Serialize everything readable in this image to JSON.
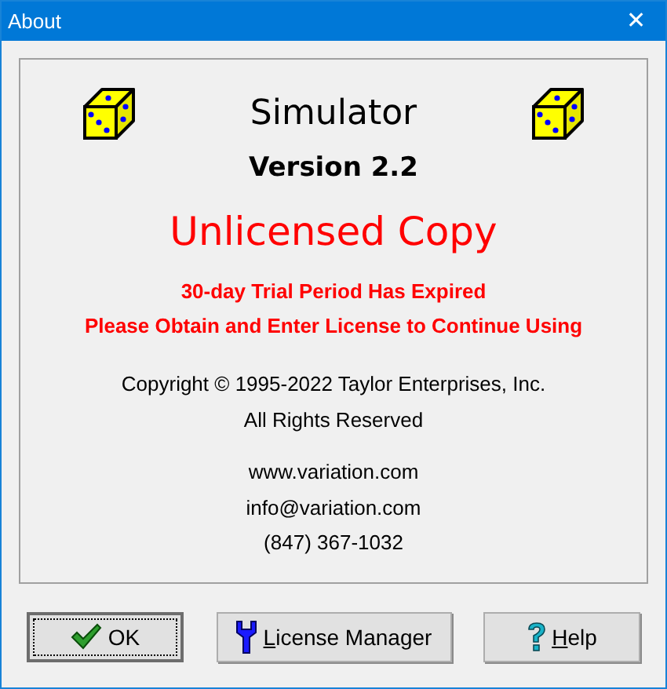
{
  "window": {
    "title": "About",
    "close": "✕"
  },
  "product": {
    "name": "Simulator",
    "version": "Version 2.2"
  },
  "license_status": "Unlicensed Copy",
  "notices": [
    "30-day Trial Period Has Expired",
    "Please Obtain and Enter License to Continue Using"
  ],
  "copyright": [
    "Copyright © 1995-2022 Taylor Enterprises, Inc.",
    "All Rights Reserved"
  ],
  "contact": [
    "www.variation.com",
    "info@variation.com",
    "(847) 367-1032"
  ],
  "buttons": [
    {
      "label": "OK",
      "kind": "ok",
      "focused": true,
      "underline_first": false
    },
    {
      "label": "License Manager",
      "kind": "license",
      "focused": false,
      "underline_first": true
    },
    {
      "label": "Help",
      "kind": "help",
      "focused": false,
      "underline_first": true
    }
  ]
}
